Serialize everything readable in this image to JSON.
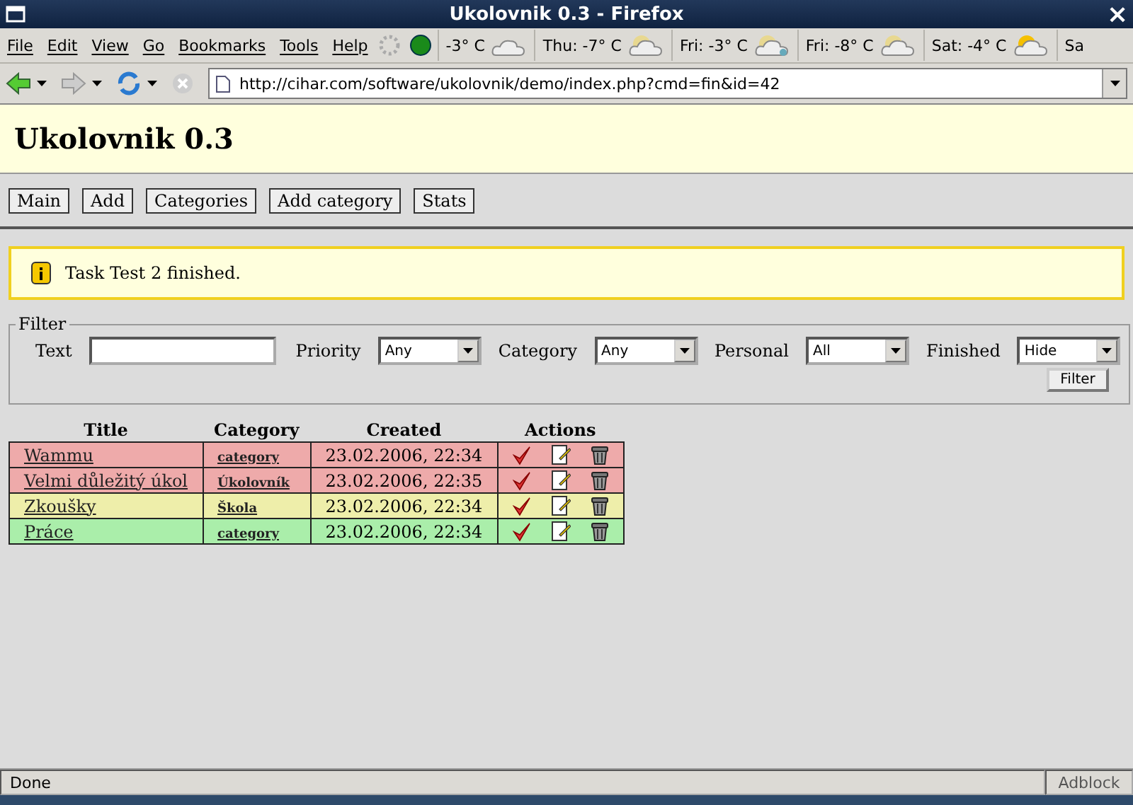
{
  "window": {
    "title": "Ukolovnik 0.3 - Firefox",
    "close": "×"
  },
  "menu": [
    "File",
    "Edit",
    "View",
    "Go",
    "Bookmarks",
    "Tools",
    "Help"
  ],
  "weather": [
    {
      "label": "-3° C",
      "kind": "cloud"
    },
    {
      "label": "Thu: -7° C",
      "kind": "suncloud"
    },
    {
      "label": "Fri: -3° C",
      "kind": "snow"
    },
    {
      "label": "Fri: -8° C",
      "kind": "suncloud"
    },
    {
      "label": "Sat: -4° C",
      "kind": "sun"
    },
    {
      "label": "Sa",
      "kind": "none"
    }
  ],
  "address": "http://cihar.com/software/ukolovnik/demo/index.php?cmd=fin&id=42",
  "page": {
    "heading": "Ukolovnik 0.3",
    "nav": [
      "Main",
      "Add",
      "Categories",
      "Add category",
      "Stats"
    ],
    "message": "Task Test 2 finished.",
    "filter": {
      "legend": "Filter",
      "text_label": "Text",
      "selects": [
        {
          "label": "Priority",
          "value": "Any"
        },
        {
          "label": "Category",
          "value": "Any"
        },
        {
          "label": "Personal",
          "value": "All"
        },
        {
          "label": "Finished",
          "value": "Hide"
        }
      ],
      "button": "Filter"
    },
    "table": {
      "columns": [
        "Title",
        "Category",
        "Created",
        "Actions"
      ],
      "rows": [
        {
          "title": "Wammu",
          "category": "category",
          "created": "23.02.2006, 22:34",
          "color": "#eeaaaa"
        },
        {
          "title": "Velmi důležitý úkol",
          "category": "Úkolovník",
          "created": "23.02.2006, 22:35",
          "color": "#eeaaaa"
        },
        {
          "title": "Zkoušky",
          "category": "Škola",
          "created": "23.02.2006, 22:34",
          "color": "#eeeeaa"
        },
        {
          "title": "Práce",
          "category": "category",
          "created": "23.02.2006, 22:34",
          "color": "#aaeeaa"
        }
      ]
    }
  },
  "status_bar": {
    "text": "Done",
    "adblock": "Adblock"
  }
}
